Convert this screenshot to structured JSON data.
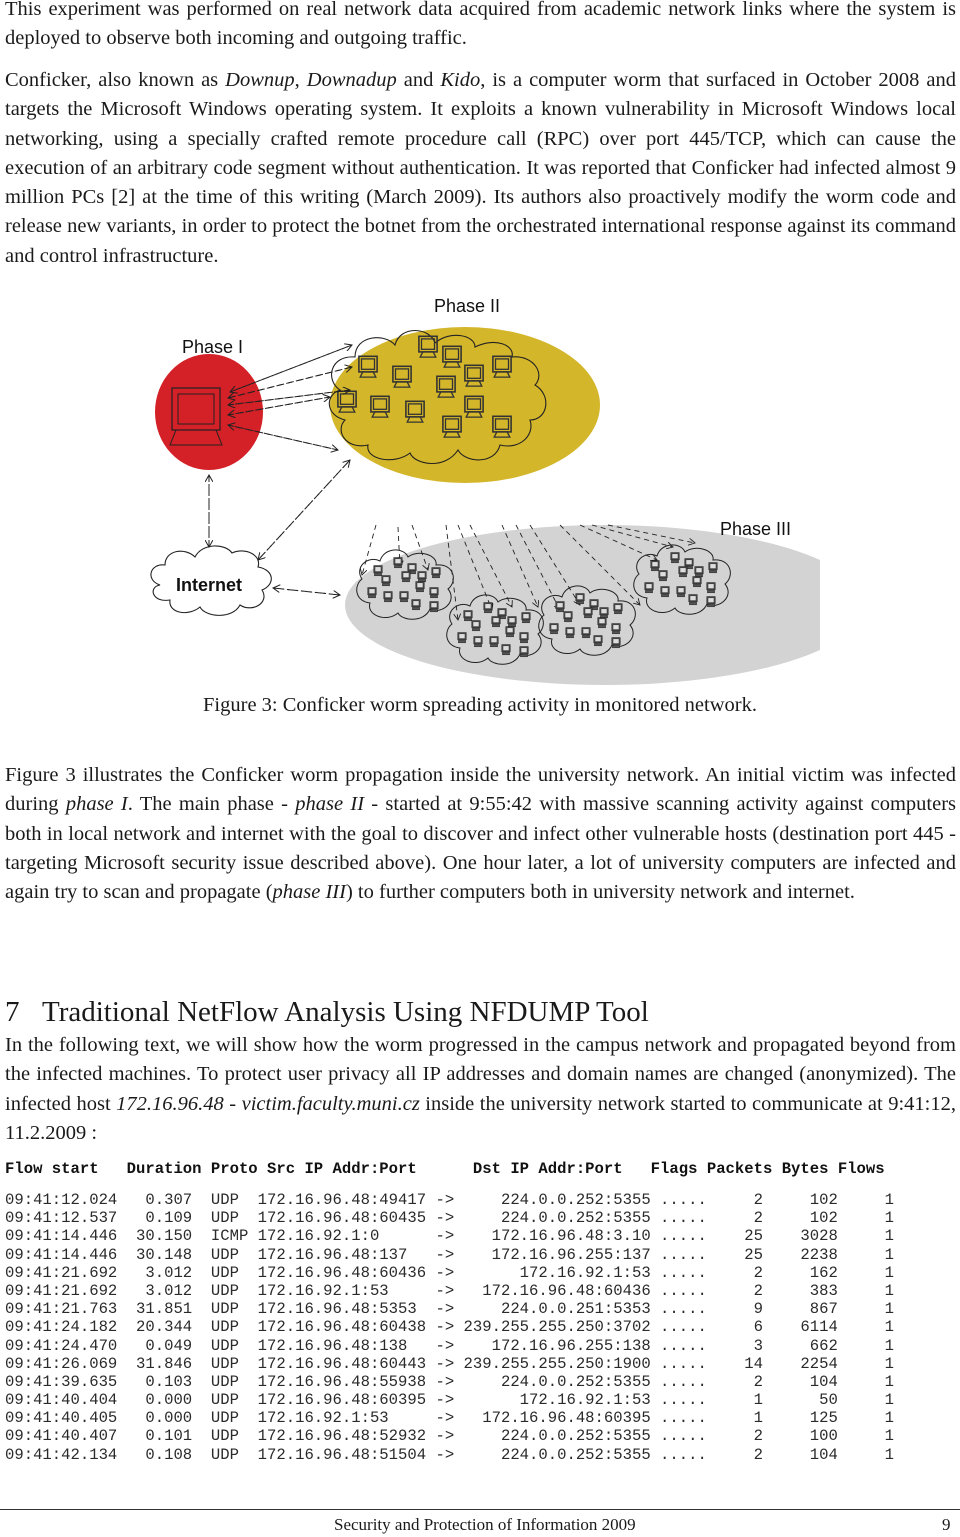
{
  "intro": {
    "p1": "This experiment was performed on real network data acquired from academic network links where the system is deployed to observe both incoming and outgoing traffic.",
    "p2": {
      "a": "Conficker, also known as ",
      "alias1": "Downup",
      "b": ", ",
      "alias2": "Downadup",
      "c": " and ",
      "alias3": "Kido",
      "d": ", is a computer worm that surfaced in October 2008 and targets the Microsoft Windows operating system. It exploits a known vulnerability in Microsoft Windows local networking, using a specially crafted remote procedure call (RPC) over port 445/TCP, which can cause the execution of an arbitrary code segment without authentication. It was reported that Conficker had infected almost 9 million PCs [2] at the time of this writing (March 2009). Its authors also proactively modify the worm code and release new variants, in order to protect the botnet from the orchestrated international response against its command and control infrastructure."
    }
  },
  "figure": {
    "labels": {
      "phase1": "Phase I",
      "phase2": "Phase II",
      "phase3": "Phase III",
      "internet": "Internet"
    },
    "colors": {
      "phase1": "#d42027",
      "phase2": "#d4b62a",
      "phase3": "#d3d3d3"
    },
    "caption": "Figure 3: Conficker worm spreading activity in monitored network."
  },
  "discussion": {
    "a": "Figure 3 illustrates the Conficker worm propagation inside the university network. An initial victim was infected during ",
    "phase1": "phase I",
    "b": ". The main phase - ",
    "phase2": "phase II",
    "c": " - started at 9:55:42 with massive scanning activity against computers both in local network and internet with the goal to discover and infect other vulnerable hosts (destination port 445 - targeting Microsoft security issue described above). One hour later, a lot of university computers are infected and again try to scan and propagate (",
    "phase3": "phase III",
    "d": ") to further computers both in university network and internet."
  },
  "section": {
    "number": "7",
    "title": "Traditional NetFlow Analysis Using NFDUMP Tool",
    "p": {
      "a": "In the following text, we will show how the worm progressed in the campus network and propagated beyond from the infected machines. To protect user privacy all IP addresses and domain names are changed (anonymized). The infected host ",
      "host": "172.16.96.48 - victim.faculty.muni.cz",
      "b": " inside the university network started to communicate at 9:41:12, 11.2.2009 :"
    }
  },
  "flows": {
    "header": "Flow start   Duration Proto Src IP Addr:Port      Dst IP Addr:Port   Flags Packets Bytes Flows",
    "columns": [
      "Flow start",
      "Duration",
      "Proto",
      "Src IP Addr:Port",
      "Dst IP Addr:Port",
      "Flags",
      "Packets",
      "Bytes",
      "Flows"
    ],
    "rows": [
      [
        "09:41:12.024",
        "0.307",
        "UDP",
        "172.16.96.48:49417",
        "224.0.0.252:5355",
        ".....",
        "2",
        "102",
        "1"
      ],
      [
        "09:41:12.537",
        "0.109",
        "UDP",
        "172.16.96.48:60435",
        "224.0.0.252:5355",
        ".....",
        "2",
        "102",
        "1"
      ],
      [
        "09:41:14.446",
        "30.150",
        "ICMP",
        "172.16.92.1:0",
        "172.16.96.48:3.10",
        ".....",
        "25",
        "3028",
        "1"
      ],
      [
        "09:41:14.446",
        "30.148",
        "UDP",
        "172.16.96.48:137",
        "172.16.96.255:137",
        ".....",
        "25",
        "2238",
        "1"
      ],
      [
        "09:41:21.692",
        "3.012",
        "UDP",
        "172.16.96.48:60436",
        "172.16.92.1:53",
        ".....",
        "2",
        "162",
        "1"
      ],
      [
        "09:41:21.692",
        "3.012",
        "UDP",
        "172.16.92.1:53",
        "172.16.96.48:60436",
        ".....",
        "2",
        "383",
        "1"
      ],
      [
        "09:41:21.763",
        "31.851",
        "UDP",
        "172.16.96.48:5353",
        "224.0.0.251:5353",
        ".....",
        "9",
        "867",
        "1"
      ],
      [
        "09:41:24.182",
        "20.344",
        "UDP",
        "172.16.96.48:60438",
        "239.255.255.250:3702",
        ".....",
        "6",
        "6114",
        "1"
      ],
      [
        "09:41:24.470",
        "0.049",
        "UDP",
        "172.16.96.48:138",
        "172.16.96.255:138",
        ".....",
        "3",
        "662",
        "1"
      ],
      [
        "09:41:26.069",
        "31.846",
        "UDP",
        "172.16.96.48:60443",
        "239.255.255.250:1900",
        ".....",
        "14",
        "2254",
        "1"
      ],
      [
        "09:41:39.635",
        "0.103",
        "UDP",
        "172.16.96.48:55938",
        "224.0.0.252:5355",
        ".....",
        "2",
        "104",
        "1"
      ],
      [
        "09:41:40.404",
        "0.000",
        "UDP",
        "172.16.96.48:60395",
        "172.16.92.1:53",
        ".....",
        "1",
        "50",
        "1"
      ],
      [
        "09:41:40.405",
        "0.000",
        "UDP",
        "172.16.92.1:53",
        "172.16.96.48:60395",
        ".....",
        "1",
        "125",
        "1"
      ],
      [
        "09:41:40.407",
        "0.101",
        "UDP",
        "172.16.96.48:52932",
        "224.0.0.252:5355",
        ".....",
        "2",
        "100",
        "1"
      ],
      [
        "09:41:42.134",
        "0.108",
        "UDP",
        "172.16.96.48:51504",
        "224.0.0.252:5355",
        ".....",
        "2",
        "104",
        "1"
      ]
    ]
  },
  "footer": {
    "title": "Security and Protection of Information 2009",
    "page": "9"
  }
}
